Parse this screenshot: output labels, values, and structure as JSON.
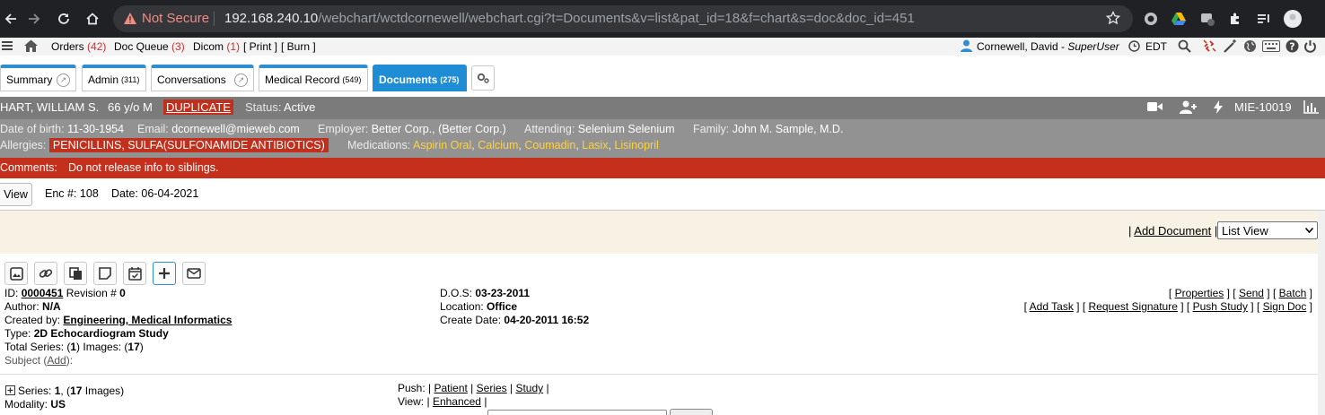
{
  "browser": {
    "not_secure": "Not Secure",
    "url_host": "192.168.240.10",
    "url_path": "/webchart/wctdcornewell/webchart.cgi?t=Documents&v=list&pat_id=18&f=chart&s=doc&doc_id=451"
  },
  "menubar": {
    "orders_label": "Orders",
    "orders_count": "(42)",
    "docqueue_label": "Doc Queue",
    "docqueue_count": "(3)",
    "dicom_label": "Dicom",
    "dicom_count": "(1)",
    "print": "[ Print ]",
    "burn": "[ Burn ]",
    "user_name": "Cornewell, David",
    "user_role": "SuperUser",
    "timezone": "EDT"
  },
  "tabs": [
    {
      "label": "Summary",
      "count": ""
    },
    {
      "label": "Admin",
      "count": "(311)"
    },
    {
      "label": "Conversations",
      "count": ""
    },
    {
      "label": "Medical Record",
      "count": "(549)"
    },
    {
      "label": "Documents",
      "count": "(275)"
    }
  ],
  "patient": {
    "name": "HART, WILLIAM S.",
    "age_sex": "66 y/o M",
    "duplicate": "DUPLICATE",
    "status_label": "Status:",
    "status": "Active",
    "mrn": "MIE-10019",
    "dob_label": "Date of birth:",
    "dob": "11-30-1954",
    "email_label": "Email:",
    "email": "dcornewell@mieweb.com",
    "employer_label": "Employer:",
    "employer": "Better Corp., (Better Corp.)",
    "attending_label": "Attending:",
    "attending": "Selenium Selenium",
    "family_label": "Family:",
    "family": "John M. Sample, M.D.",
    "allergies_label": "Allergies:",
    "allergies": "PENICILLINS, SULFA(SULFONAMIDE ANTIBIOTICS)",
    "medications_label": "Medications:",
    "medications": [
      "Aspirin Oral",
      "Calcium",
      "Coumadin",
      "Lasix",
      "Lisinopril"
    ],
    "comments_label": "Comments:",
    "comments": "Do not release info to siblings."
  },
  "encounter": {
    "view": "View",
    "enc_label": "Enc #:",
    "enc": "108",
    "date_label": "Date:",
    "date": "06-04-2021"
  },
  "doclist": {
    "add_document": "Add Document",
    "view_select": "List View"
  },
  "document": {
    "id_label": "ID:",
    "id": "0000451",
    "revision_label": "Revision #",
    "revision": "0",
    "author_label": "Author:",
    "author": "N/A",
    "created_by_label": "Created by:",
    "created_by": "Engineering, Medical Informatics",
    "type_label": "Type:",
    "type": "2D Echocardiogram Study",
    "total_series_label": "Total Series: (",
    "total_series": "1",
    "images_label": ") Images: (",
    "images": "17",
    "subject_label": "Subject (",
    "subject_add": "Add",
    "dos_label": "D.O.S:",
    "dos": "03-23-2011",
    "location_label": "Location:",
    "location": "Office",
    "create_date_label": "Create Date:",
    "create_date": "04-20-2011 16:52",
    "actions1": [
      "Properties",
      "Send",
      "Batch"
    ],
    "actions2": [
      "Add Task",
      "Request Signature",
      "Push Study",
      "Sign Doc"
    ]
  },
  "series": {
    "series_label": "Series:",
    "series_num": "1",
    "images_count": "17",
    "images_word": "Images",
    "modality_label": "Modality:",
    "modality": "US",
    "push_label": "Push:",
    "push_links": [
      "Patient",
      "Series",
      "Study"
    ],
    "view_label": "View:",
    "view_link": "Enhanced"
  },
  "colors": {
    "tab_accent": "#1f8dd6",
    "alert_red": "#c4301c",
    "med_yellow": "#ffd23f"
  }
}
